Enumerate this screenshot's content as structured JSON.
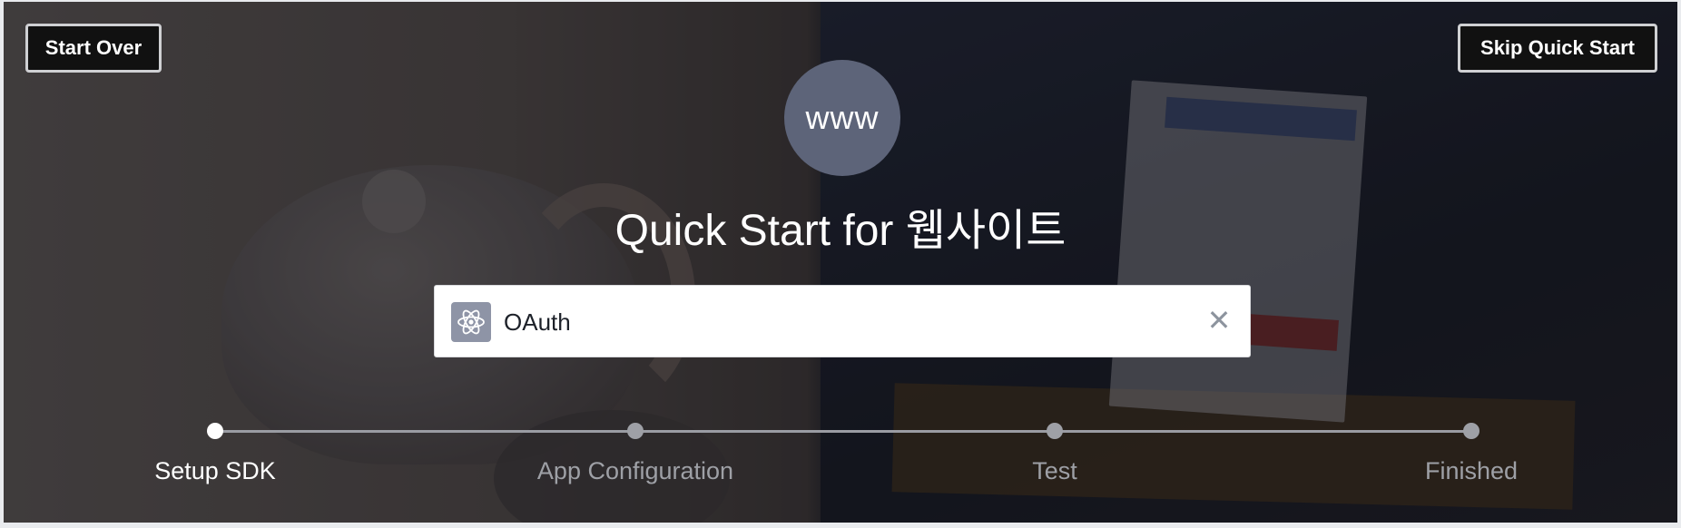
{
  "header": {
    "start_over_label": "Start Over",
    "skip_label": "Skip Quick Start"
  },
  "platform": {
    "icon_text": "www",
    "title": "Quick Start for 웹사이트"
  },
  "search": {
    "value": "OAuth",
    "app_icon": "atom-icon",
    "clear_icon": "close-icon"
  },
  "steps": [
    {
      "label": "Setup SDK",
      "active": true
    },
    {
      "label": "App Configuration",
      "active": false
    },
    {
      "label": "Test",
      "active": false
    },
    {
      "label": "Finished",
      "active": false
    }
  ],
  "colors": {
    "platform_circle": "#5d6479",
    "active_step": "#ffffff",
    "inactive_step": "#9ea0a6"
  }
}
